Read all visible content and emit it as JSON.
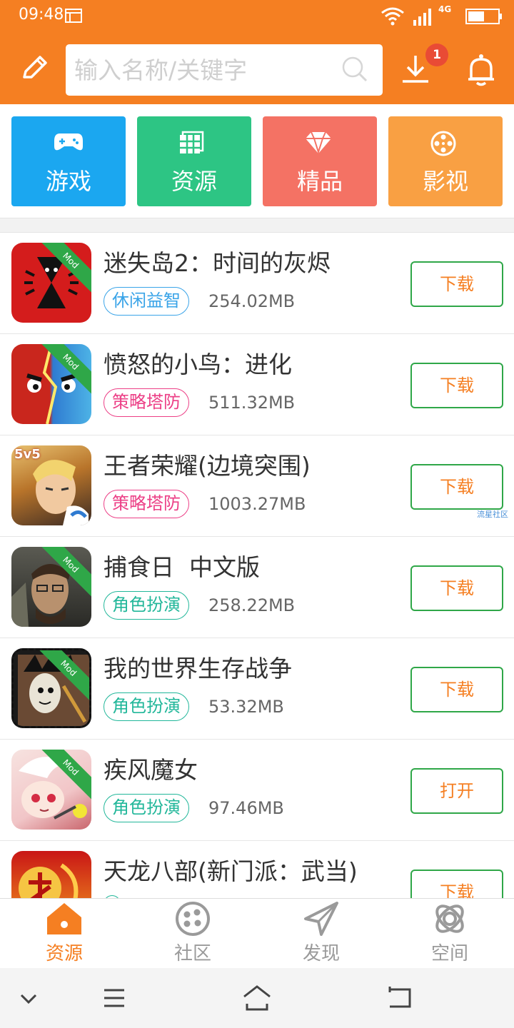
{
  "status_bar": {
    "time": "09:48",
    "network": "4G"
  },
  "search": {
    "placeholder": "输入名称/关键字"
  },
  "header": {
    "download_badge": "1"
  },
  "colors": {
    "accent": "#f57f22",
    "games": "#1ba7f0",
    "resources": "#2dc584",
    "featured": "#f47264",
    "video": "#f9a043",
    "button_border": "#2fa748"
  },
  "categories": [
    {
      "label": "游戏",
      "icon": "gamepad-icon"
    },
    {
      "label": "资源",
      "icon": "grid-icon"
    },
    {
      "label": "精品",
      "icon": "diamond-icon"
    },
    {
      "label": "影视",
      "icon": "film-reel-icon"
    }
  ],
  "apps": [
    {
      "name": "迷失岛2：时间的灰烬",
      "tag": "休闲益智",
      "size": "254.02MB",
      "action": "下载",
      "mod": "Mod"
    },
    {
      "name": "愤怒的小鸟：进化",
      "tag": "策略塔防",
      "size": "511.32MB",
      "action": "下载",
      "mod": "Mod"
    },
    {
      "name": "王者荣耀(边境突围)",
      "tag": "策略塔防",
      "size": "1003.27MB",
      "action": "下载",
      "icon_text": "5v5"
    },
    {
      "name": "捕食日  中文版",
      "tag": "角色扮演",
      "size": "258.22MB",
      "action": "下载",
      "mod": "Mod"
    },
    {
      "name": "我的世界生存战争",
      "tag": "角色扮演",
      "size": "53.32MB",
      "action": "下载",
      "mod": "Mod"
    },
    {
      "name": "疾风魔女",
      "tag": "角色扮演",
      "size": "97.46MB",
      "action": "打开",
      "mod": "Mod"
    },
    {
      "name": "天龙八部(新门派：武当)",
      "action": "下载"
    }
  ],
  "watermark": "流星社区",
  "bottom_nav": [
    {
      "label": "资源",
      "icon": "home-icon"
    },
    {
      "label": "社区",
      "icon": "community-icon"
    },
    {
      "label": "发现",
      "icon": "paper-plane-icon"
    },
    {
      "label": "空间",
      "icon": "orbit-icon"
    }
  ]
}
